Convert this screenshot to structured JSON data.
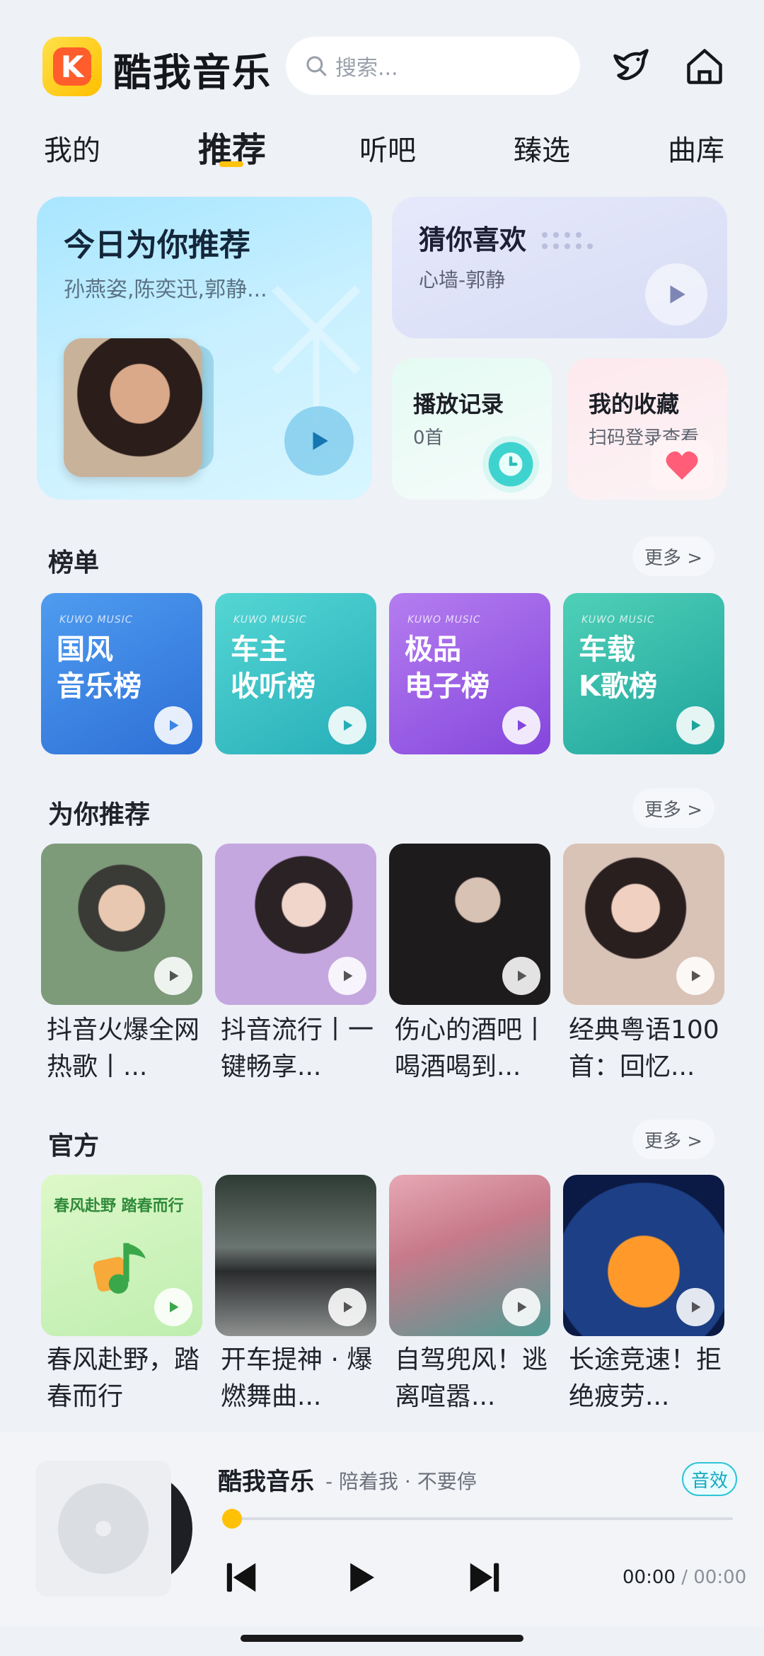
{
  "header": {
    "app_title": "酷我音乐",
    "logo_letter": "K",
    "search_placeholder": "搜索...",
    "icons": [
      "bird-icon",
      "home-icon"
    ]
  },
  "tabs": [
    {
      "label": "我的",
      "active": false
    },
    {
      "label": "推荐",
      "active": true
    },
    {
      "label": "听吧",
      "active": false
    },
    {
      "label": "臻选",
      "active": false
    },
    {
      "label": "曲库",
      "active": false
    }
  ],
  "hero": {
    "today": {
      "title": "今日为你推荐",
      "artists": "孙燕姿,陈奕迅,郭静..."
    },
    "guess": {
      "title": "猜你喜欢",
      "song": "心墙-郭静"
    },
    "history": {
      "title": "播放记录",
      "count": "0首"
    },
    "favorites": {
      "title": "我的收藏",
      "hint": "扫码登录查看"
    }
  },
  "charts_section": {
    "title": "榜单",
    "more": "更多 >",
    "items": [
      {
        "tag": "KUWO MUSIC",
        "name": "国风\n音乐榜",
        "color1": "#3b86e6",
        "color2": "#6bb7f0"
      },
      {
        "tag": "KUWO MUSIC",
        "name": "车主\n收听榜",
        "color1": "#2fc1c7",
        "color2": "#6fd9d4"
      },
      {
        "tag": "KUWO MUSIC",
        "name": "极品\n电子榜",
        "color1": "#9a5ae6",
        "color2": "#c086f0"
      },
      {
        "tag": "KUWO MUSIC",
        "name": "车载\nK歌榜",
        "color1": "#25b3a8",
        "color2": "#5ed1be"
      }
    ]
  },
  "recommend_section": {
    "title": "为你推荐",
    "more": "更多 >",
    "items": [
      {
        "caption": "抖音火爆全网热歌丨...",
        "c1": "#5a8a5f",
        "c2": "#c9d7c4"
      },
      {
        "caption": "抖音流行丨一键畅享...",
        "c1": "#b58bd6",
        "c2": "#e9c8ef"
      },
      {
        "caption": "伤心的酒吧丨喝酒喝到...",
        "c1": "#2a2526",
        "c2": "#7a6a62"
      },
      {
        "caption": "经典粤语100首：回忆...",
        "c1": "#d8b9a8",
        "c2": "#f0e2d8"
      }
    ]
  },
  "official_section": {
    "title": "官方",
    "more": "更多 >",
    "items": [
      {
        "caption": "春风赴野，踏春而行",
        "banner": "春风赴野 踏春而行",
        "c1": "#c9f0b8",
        "c2": "#eafbd9"
      },
      {
        "caption": "开车提神 · 爆燃舞曲...",
        "c1": "#3c4a40",
        "c2": "#9aa29e"
      },
      {
        "caption": "自驾兜风！逃离喧嚣...",
        "c1": "#d9899a",
        "c2": "#5fb2a8"
      },
      {
        "caption": "长途竞速！拒绝疲劳...",
        "c1": "#0e2e6a",
        "c2": "#f08a2a"
      }
    ]
  },
  "player": {
    "title": "酷我音乐",
    "subtitle": "- 陪着我 · 不要停",
    "effect_label": "音效",
    "progress": 0,
    "current_time": "00:00",
    "separator": "/",
    "total_time": "00:00",
    "controls": [
      "prev-icon",
      "play-icon",
      "next-icon"
    ]
  },
  "colors": {
    "accent": "#ffc20e",
    "background": "#eef1f6",
    "effect_badge": "#2ec4d6"
  }
}
